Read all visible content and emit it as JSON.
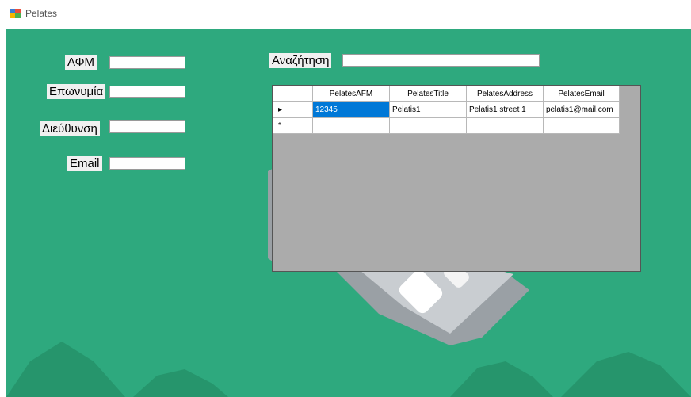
{
  "window": {
    "title": "Pelates"
  },
  "form": {
    "afm_label": "ΑΦΜ",
    "eponymia_label": "Επωνυμία",
    "dieuthynsi_label": "Διεύθυνση",
    "email_label": "Email",
    "search_label": "Αναζήτηση",
    "afm_value": "",
    "eponymia_value": "",
    "dieuthynsi_value": "",
    "email_value": "",
    "search_value": ""
  },
  "grid": {
    "columns": [
      "PelatesAFM",
      "PelatesTitle",
      "PelatesAddress",
      "PelatesEmail"
    ],
    "rows": [
      {
        "indicator": "▸",
        "cells": [
          "12345",
          "Pelatis1",
          "Pelatis1 street 1",
          "pelatis1@mail.com"
        ]
      },
      {
        "indicator": "*",
        "cells": [
          "",
          "",
          "",
          ""
        ]
      }
    ]
  },
  "colors": {
    "background": "#2ea97e",
    "grid_background": "#ababab",
    "selection": "#0078d7"
  },
  "icons": {
    "app": "app-window-icon"
  }
}
